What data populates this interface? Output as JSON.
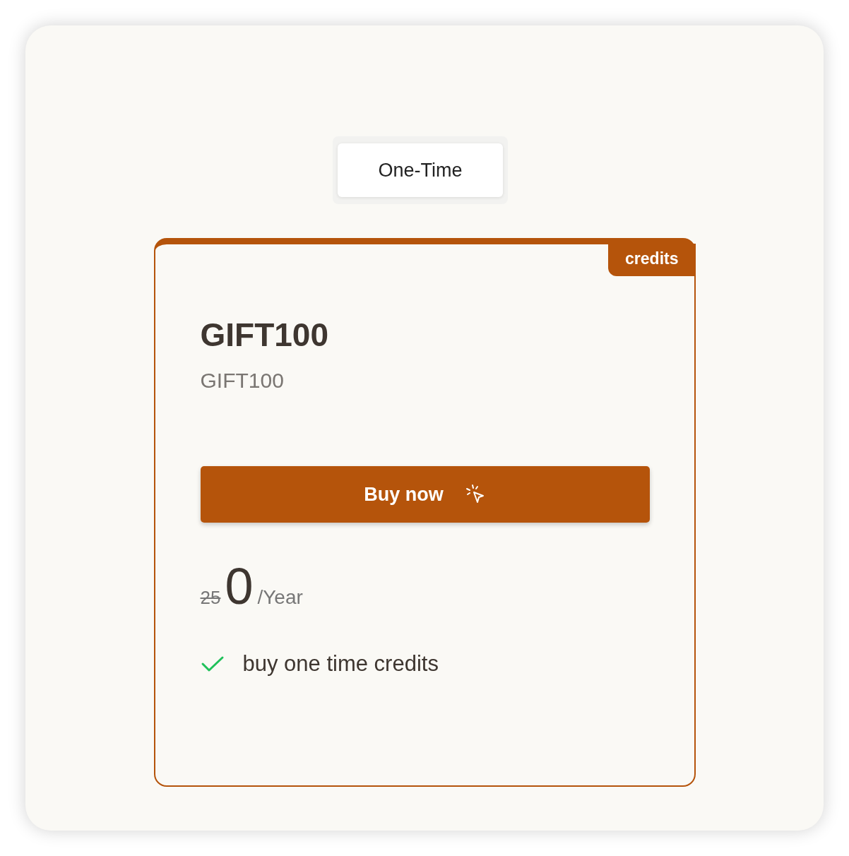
{
  "tabs": [
    {
      "label": "One-Time",
      "selected": true
    }
  ],
  "plan": {
    "badge": "credits",
    "title": "GIFT100",
    "subtitle": "GIFT100",
    "button": "Buy now",
    "original_price": "25",
    "price": "0",
    "period": "/Year",
    "features": [
      {
        "text": "buy one time credits",
        "included": true
      }
    ]
  }
}
